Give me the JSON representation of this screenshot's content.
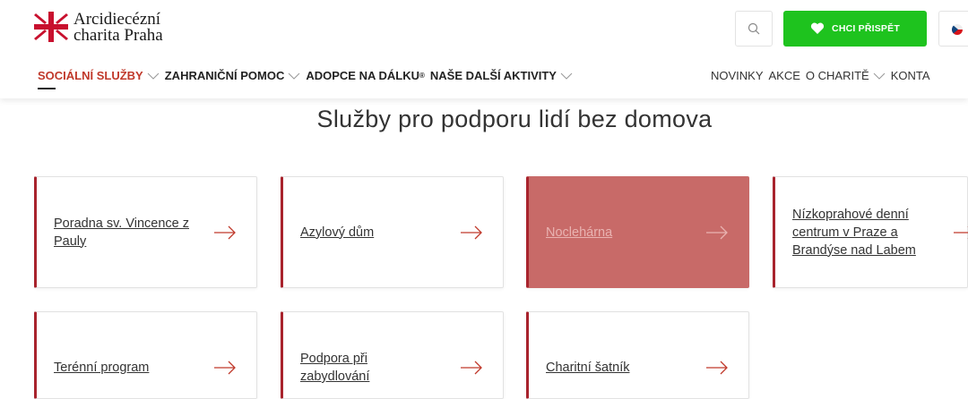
{
  "header": {
    "logo_line1": "Arcidiecézní",
    "logo_line2": "charita Praha",
    "search_icon": "search-icon",
    "donate_label": "CHCI PŘISPĚT",
    "donate_icon": "heart-icon",
    "brand_green": "#1ec31e",
    "brand_red": "#a8232d"
  },
  "nav": {
    "left": [
      {
        "label": "SOCIÁLNÍ SLUŽBY",
        "has_dropdown": true,
        "active": true
      },
      {
        "label": "ZAHRANIČNÍ POMOC",
        "has_dropdown": true
      },
      {
        "label": "ADOPCE NA DÁLKU",
        "sup": "®",
        "has_dropdown": false
      },
      {
        "label": "NAŠE DALŠÍ AKTIVITY",
        "has_dropdown": true
      }
    ],
    "right": [
      {
        "label": "NOVINKY",
        "has_dropdown": false
      },
      {
        "label": "AKCE",
        "has_dropdown": false
      },
      {
        "label": "O CHARITĚ",
        "has_dropdown": true
      },
      {
        "label": "KONTA",
        "has_dropdown": false
      }
    ]
  },
  "main": {
    "title": "Služby pro podporu lidí bez domova",
    "cards": [
      {
        "label": "Poradna sv. Vincence z Pauly",
        "active": false
      },
      {
        "label": "Azylový dům",
        "active": false
      },
      {
        "label": "Noclehárna",
        "active": true
      },
      {
        "label": "Nízkoprahové denní centrum v Praze a Brandýse nad Labem",
        "active": false
      },
      {
        "label": "Terénní program",
        "active": false
      },
      {
        "label": "Podpora při zabydlování",
        "active": false
      },
      {
        "label": "Charitní šatník",
        "active": false
      }
    ]
  }
}
